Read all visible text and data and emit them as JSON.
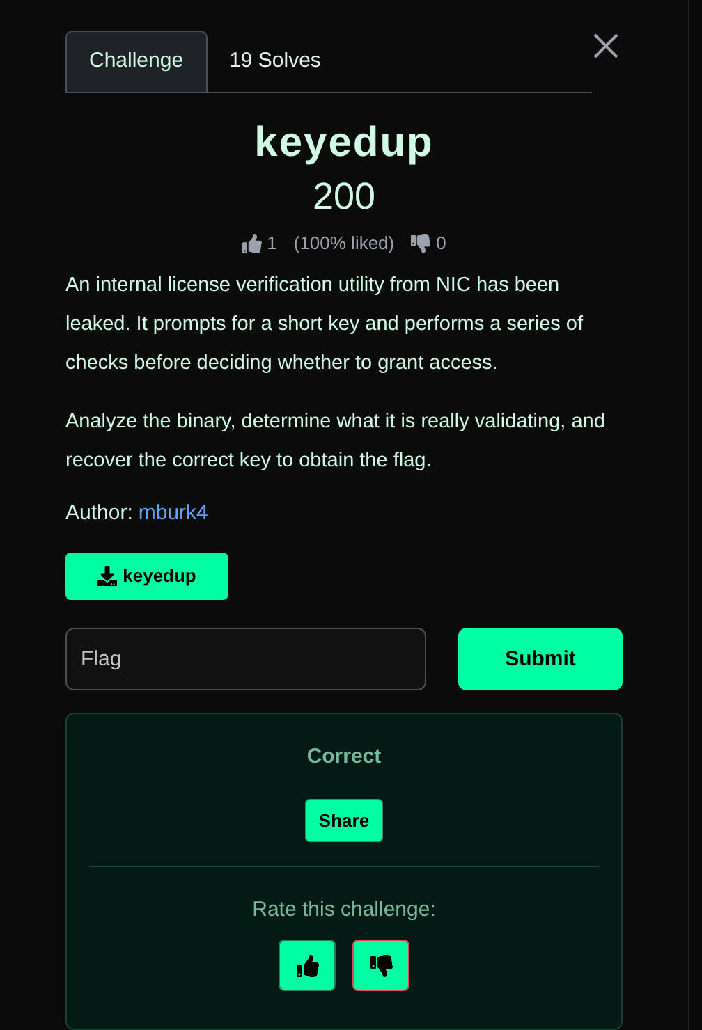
{
  "tabs": [
    {
      "label": "Challenge",
      "selected": true
    },
    {
      "label": "19 Solves",
      "selected": false
    }
  ],
  "title": "keyedup",
  "points": "200",
  "votes": {
    "likes": "1",
    "liked_share": "(100% liked)",
    "dislikes": "0"
  },
  "description": [
    "An internal license verification utility from NIC has been leaked. It prompts for a short key and performs a series of checks before deciding whether to grant access.",
    "Analyze the binary, determine what it is really validating, and recover the correct key to obtain the flag."
  ],
  "author": {
    "label": "Author:",
    "name": "mburk4"
  },
  "download": {
    "label": "keyedup"
  },
  "flag_field": {
    "placeholder": "Flag"
  },
  "submit": "Submit",
  "result": {
    "status": "Correct",
    "share": "Share",
    "rate_prompt": "Rate this challenge:",
    "rate_buttons": [
      {
        "kind": "up"
      },
      {
        "kind": "down"
      }
    ]
  }
}
